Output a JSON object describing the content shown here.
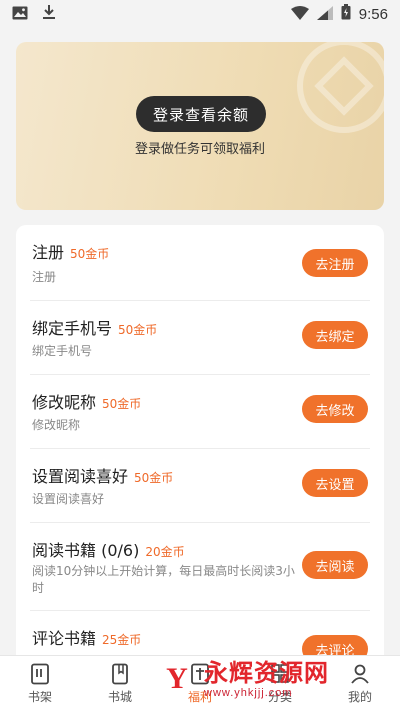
{
  "status_bar": {
    "time": "9:56",
    "left_icons": [
      "image-icon",
      "download-icon"
    ],
    "right_icons": [
      "wifi-icon",
      "signal-icon",
      "battery-charging-icon"
    ]
  },
  "balance": {
    "login_button": "登录查看余额",
    "subtitle": "登录做任务可领取福利"
  },
  "tasks": [
    {
      "title": "注册",
      "reward": "50金币",
      "desc": "注册",
      "button": "去注册"
    },
    {
      "title": "绑定手机号",
      "reward": "50金币",
      "desc": "绑定手机号",
      "button": "去绑定"
    },
    {
      "title": "修改昵称",
      "reward": "50金币",
      "desc": "修改昵称",
      "button": "去修改"
    },
    {
      "title": "设置阅读喜好",
      "reward": "50金币",
      "desc": "设置阅读喜好",
      "button": "去设置"
    },
    {
      "title": "阅读书籍 (0/6)",
      "reward": "20金币",
      "desc": "阅读10分钟以上开始计算，每日最高时长阅读3小时",
      "button": "去阅读"
    },
    {
      "title": "评论书籍",
      "reward": "25金币",
      "desc": "",
      "button": "去评论"
    }
  ],
  "tab_bar": {
    "tabs": [
      {
        "label": "书架",
        "icon": "bookshelf-icon"
      },
      {
        "label": "书城",
        "icon": "bookstore-icon"
      },
      {
        "label": "福利",
        "icon": "gift-icon"
      },
      {
        "label": "分类",
        "icon": "category-icon"
      },
      {
        "label": "我的",
        "icon": "profile-icon"
      }
    ],
    "active": "福利"
  },
  "watermark": {
    "logo_text": "Y",
    "title": "永辉资源网",
    "url": "www.yhkjjj.com"
  },
  "colors": {
    "accent": "#f0722b",
    "reward": "#ef6a2a",
    "card_gold": "#efdcb4",
    "login_button": "#2d2d2d"
  }
}
